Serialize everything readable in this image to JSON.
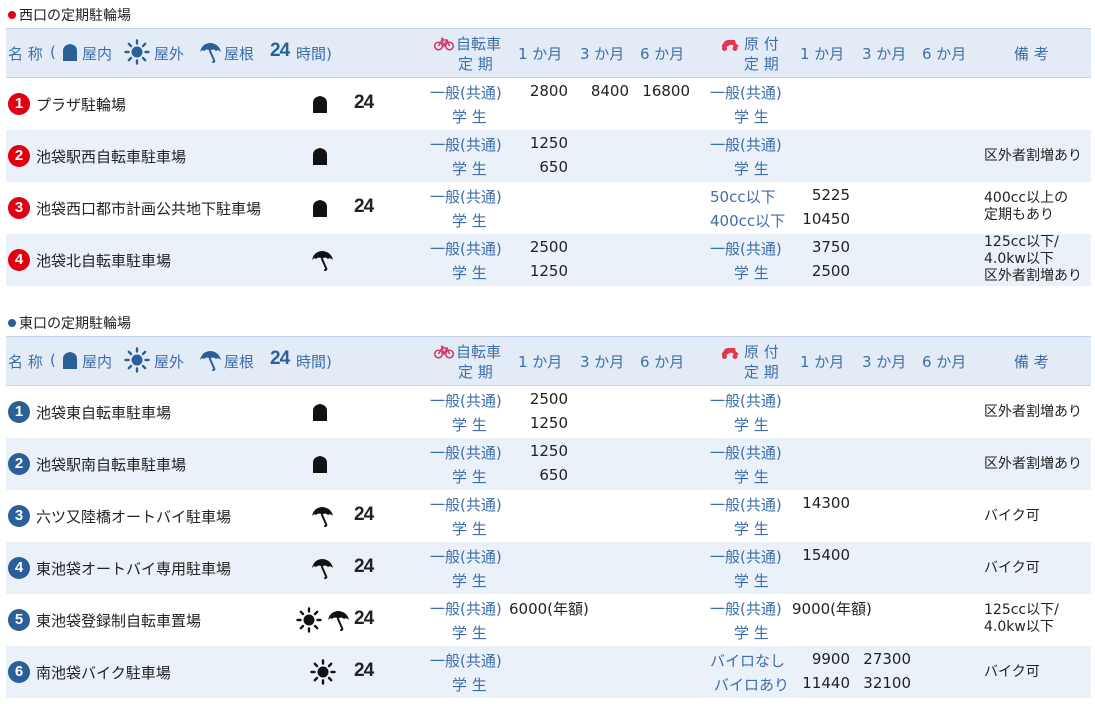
{
  "west": {
    "section_title": "西口の定期駐輪場",
    "header": {
      "name": "名 称",
      "paren_open": "(",
      "indoor": "屋内",
      "outdoor": "屋外",
      "roof": "屋根",
      "h24": "24",
      "hours": "時間)",
      "bicycle_line1": "自転車",
      "bicycle_line2": "定 期",
      "m1": "1 か月",
      "m3": "3 か月",
      "m6": "6 か月",
      "moped_line1": "原 付",
      "moped_line2": "定 期",
      "mm1": "1 か月",
      "mm3": "3 か月",
      "mm6": "6 か月",
      "remarks": "備  考"
    },
    "rows": [
      {
        "no": "1",
        "name": "プラザ駐輪場",
        "icons": [
          "indoor"
        ],
        "h24": "24",
        "bike_l1": "一般(共通)",
        "bike_l2": "学 生",
        "b1_1": "2800",
        "b3_1": "8400",
        "b6_1": "16800",
        "b1_2": "",
        "moped_l1": "一般(共通)",
        "moped_l2": "学 生",
        "m1_1": "",
        "m3_1": "",
        "m1_2": "",
        "m3_2": "",
        "note": []
      },
      {
        "no": "2",
        "name": "池袋駅西自転車駐車場",
        "icons": [
          "indoor"
        ],
        "h24": "",
        "bike_l1": "一般(共通)",
        "bike_l2": "学 生",
        "b1_1": "1250",
        "b3_1": "",
        "b6_1": "",
        "b1_2": "650",
        "moped_l1": "一般(共通)",
        "moped_l2": "学 生",
        "m1_1": "",
        "m3_1": "",
        "m1_2": "",
        "m3_2": "",
        "note": [
          "区外者割増あり"
        ]
      },
      {
        "no": "3",
        "name": "池袋西口都市計画公共地下駐車場",
        "icons": [
          "indoor"
        ],
        "h24": "24",
        "bike_l1": "一般(共通)",
        "bike_l2": "学 生",
        "b1_1": "",
        "b3_1": "",
        "b6_1": "",
        "b1_2": "",
        "moped_l1": "50cc以下",
        "moped_l2": "400cc以下",
        "m1_1": "5225",
        "m3_1": "",
        "m1_2": "10450",
        "m3_2": "",
        "note": [
          "400cc以上の",
          "定期もあり"
        ]
      },
      {
        "no": "4",
        "name": "池袋北自転車駐車場",
        "icons": [
          "roof"
        ],
        "h24": "",
        "bike_l1": "一般(共通)",
        "bike_l2": "学 生",
        "b1_1": "2500",
        "b3_1": "",
        "b6_1": "",
        "b1_2": "1250",
        "moped_l1": "一般(共通)",
        "moped_l2": "学 生",
        "m1_1": "3750",
        "m3_1": "",
        "m1_2": "2500",
        "m3_2": "",
        "note": [
          "125cc以下/",
          "4.0kw以下",
          "区外者割増あり"
        ]
      }
    ]
  },
  "east": {
    "section_title": "東口の定期駐輪場",
    "header": {
      "name": "名 称",
      "paren_open": "(",
      "indoor": "屋内",
      "outdoor": "屋外",
      "roof": "屋根",
      "h24": "24",
      "hours": "時間)",
      "bicycle_line1": "自転車",
      "bicycle_line2": "定 期",
      "m1": "1 か月",
      "m3": "3 か月",
      "m6": "6 か月",
      "moped_line1": "原 付",
      "moped_line2": "定 期",
      "mm1": "1 か月",
      "mm3": "3 か月",
      "mm6": "6 か月",
      "remarks": "備  考"
    },
    "rows": [
      {
        "no": "1",
        "name": "池袋東自転車駐車場",
        "icons": [
          "indoor"
        ],
        "h24": "",
        "bike_l1": "一般(共通)",
        "bike_l2": "学 生",
        "b1_1": "2500",
        "b3_1": "",
        "b6_1": "",
        "b1_2": "1250",
        "moped_l1": "一般(共通)",
        "moped_l2": "学 生",
        "m1_1": "",
        "m3_1": "",
        "m1_2": "",
        "m3_2": "",
        "note": [
          "区外者割増あり"
        ]
      },
      {
        "no": "2",
        "name": "池袋駅南自転車駐車場",
        "icons": [
          "indoor"
        ],
        "h24": "",
        "bike_l1": "一般(共通)",
        "bike_l2": "学 生",
        "b1_1": "1250",
        "b3_1": "",
        "b6_1": "",
        "b1_2": "650",
        "moped_l1": "一般(共通)",
        "moped_l2": "学 生",
        "m1_1": "",
        "m3_1": "",
        "m1_2": "",
        "m3_2": "",
        "note": [
          "区外者割増あり"
        ]
      },
      {
        "no": "3",
        "name": "六ツ又陸橋オートバイ駐車場",
        "icons": [
          "roof"
        ],
        "h24": "24",
        "bike_l1": "一般(共通)",
        "bike_l2": "学 生",
        "b1_1": "",
        "b3_1": "",
        "b6_1": "",
        "b1_2": "",
        "moped_l1": "一般(共通)",
        "moped_l2": "学 生",
        "m1_1": "14300",
        "m3_1": "",
        "m1_2": "",
        "m3_2": "",
        "note": [
          "バイク可"
        ]
      },
      {
        "no": "4",
        "name": "東池袋オートバイ専用駐車場",
        "icons": [
          "roof"
        ],
        "h24": "24",
        "bike_l1": "一般(共通)",
        "bike_l2": "学 生",
        "b1_1": "",
        "b3_1": "",
        "b6_1": "",
        "b1_2": "",
        "moped_l1": "一般(共通)",
        "moped_l2": "学 生",
        "m1_1": "15400",
        "m3_1": "",
        "m1_2": "",
        "m3_2": "",
        "note": [
          "バイク可"
        ]
      },
      {
        "no": "5",
        "name": "東池袋登録制自転車置場",
        "icons": [
          "outdoor",
          "roof"
        ],
        "h24": "24",
        "bike_l1": "一般(共通)",
        "bike_l2": "学 生",
        "b1_1": "6000(年額)",
        "b3_1": "",
        "b6_1": "",
        "b1_2": "",
        "moped_l1": "一般(共通)",
        "moped_l2": "学 生",
        "m1_1": "9000(年額)",
        "m3_1": "",
        "m1_2": "",
        "m3_2": "",
        "note": [
          "125cc以下/",
          "4.0kw以下"
        ]
      },
      {
        "no": "6",
        "name": "南池袋バイク駐車場",
        "icons": [
          "outdoor"
        ],
        "h24": "24",
        "bike_l1": "一般(共通)",
        "bike_l2": "学 生",
        "b1_1": "",
        "b3_1": "",
        "b6_1": "",
        "b1_2": "",
        "moped_l1": "バイロなし",
        "moped_l2": "バイロあり",
        "m1_1": "9900",
        "m3_1": "27300",
        "m1_2": "11440",
        "m3_2": "32100",
        "note": [
          "バイク可"
        ]
      }
    ]
  },
  "colors": {
    "west_badge": "#e00012",
    "east_badge": "#2b5f98",
    "header_bg": "#e3ecf6",
    "alt_row": "#eaf1f8",
    "accent_text": "#3d6eaa"
  }
}
